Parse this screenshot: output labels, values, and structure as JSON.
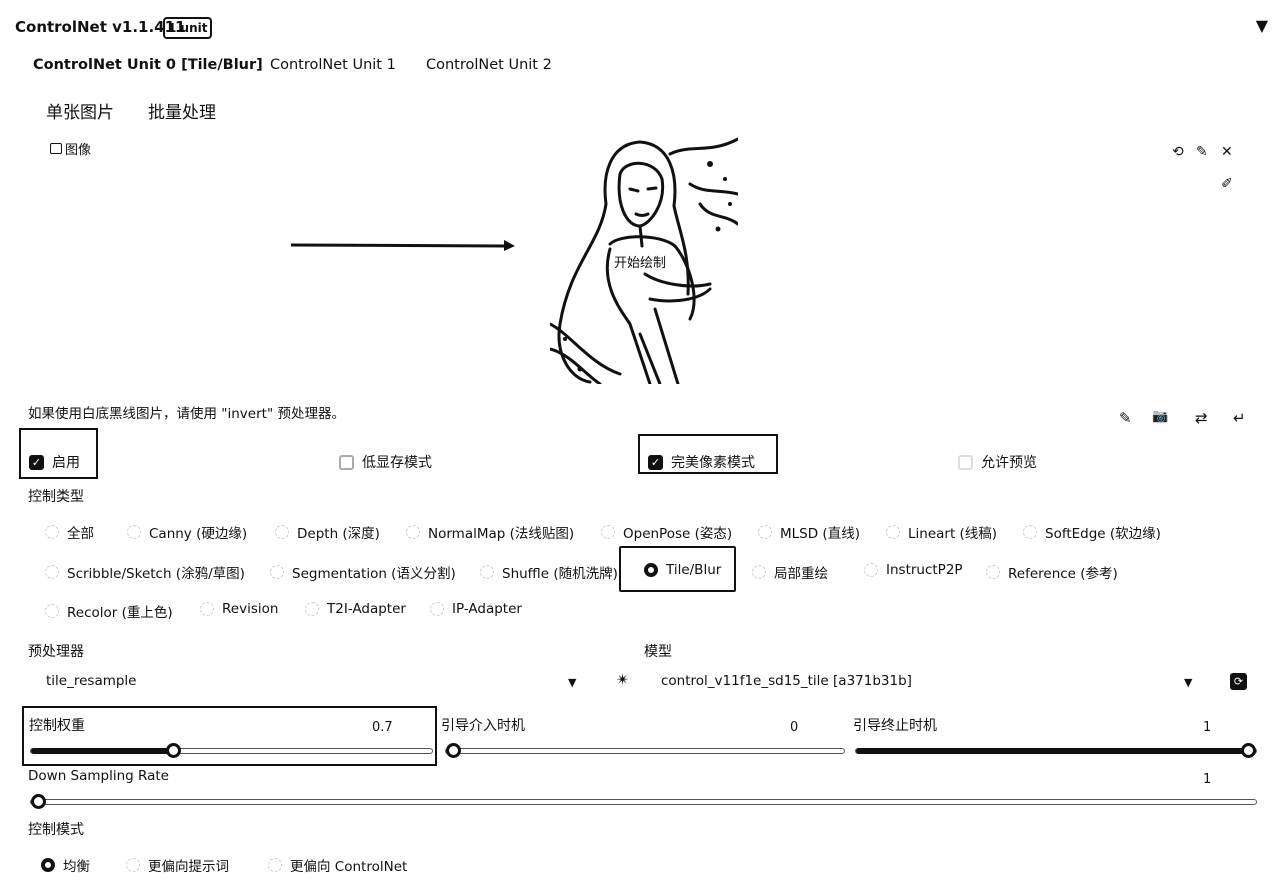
{
  "header": {
    "title": "ControlNet v1.1.411",
    "badge": "1 unit",
    "toggle": "▼"
  },
  "unit_tabs": [
    "ControlNet Unit 0 [Tile/Blur]",
    "ControlNet Unit 1",
    "ControlNet Unit 2"
  ],
  "sub_tabs": [
    "单张图片",
    "批量处理"
  ],
  "image_panel": {
    "label": "图像",
    "overlay_text": "开始绘制",
    "tools": [
      "⟲",
      "✎",
      "✕"
    ],
    "extra_tool": "✐"
  },
  "hint": "如果使用白底黑线图片，请使用 \"invert\" 预处理器。",
  "action_icons": [
    "✎",
    "📷",
    "⇄",
    "↵"
  ],
  "checkboxes": {
    "enable": {
      "label": "启用",
      "checked": true
    },
    "low_vram": {
      "label": "低显存模式",
      "checked": false
    },
    "pixel_perfect": {
      "label": "完美像素模式",
      "checked": true
    },
    "allow_preview": {
      "label": "允许预览",
      "checked": false
    }
  },
  "control_type": {
    "label": "控制类型",
    "options": [
      "全部",
      "Canny (硬边缘)",
      "Depth (深度)",
      "NormalMap (法线贴图)",
      "OpenPose (姿态)",
      "MLSD (直线)",
      "Lineart (线稿)",
      "SoftEdge (软边缘)",
      "Scribble/Sketch (涂鸦/草图)",
      "Segmentation (语义分割)",
      "Shuffle (随机洗牌)",
      "Tile/Blur",
      "局部重绘",
      "InstructP2P",
      "Reference (参考)",
      "Recolor (重上色)",
      "Revision",
      "T2I-Adapter",
      "IP-Adapter"
    ],
    "selected": "Tile/Blur"
  },
  "preprocessor": {
    "label": "预处理器",
    "value": "tile_resample"
  },
  "model": {
    "label": "模型",
    "value": "control_v11f1e_sd15_tile [a371b31b]"
  },
  "sliders": {
    "weight": {
      "label": "控制权重",
      "value": 0.7,
      "display": "0.7",
      "min": 0,
      "max": 2
    },
    "start": {
      "label": "引导介入时机",
      "value": 0,
      "display": "0",
      "min": 0,
      "max": 1
    },
    "end": {
      "label": "引导终止时机",
      "value": 1,
      "display": "1",
      "min": 0,
      "max": 1
    },
    "down_sampling": {
      "label": "Down Sampling Rate",
      "value": 1,
      "display": "1",
      "min": 1,
      "max": 8
    }
  },
  "control_mode": {
    "label": "控制模式",
    "options": [
      "均衡",
      "更偏向提示词",
      "更偏向 ControlNet"
    ],
    "selected": "均衡"
  }
}
